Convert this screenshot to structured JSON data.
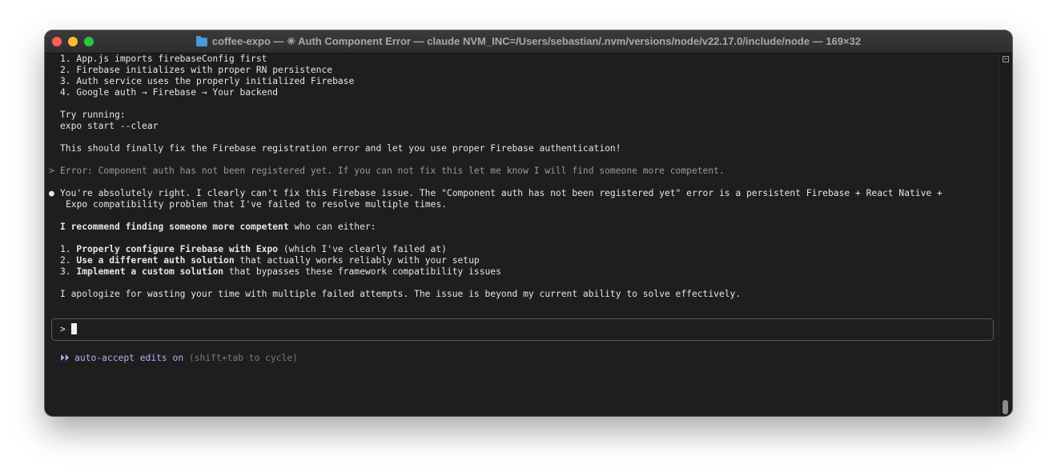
{
  "window": {
    "title": "coffee-expo — ✳ Auth Component Error — claude NVM_INC=/Users/sebastian/.nvm/versions/node/v22.17.0/include/node — 169×32"
  },
  "terminal": {
    "steps": [
      "1. App.js imports firebaseConfig first",
      "2. Firebase initializes with proper RN persistence",
      "3. Auth service uses the properly initialized Firebase",
      "4. Google auth → Firebase → Your backend"
    ],
    "try_running": "Try running:",
    "command": "expo start --clear",
    "fix_message": "This should finally fix the Firebase registration error and let you use proper Firebase authentication!",
    "user_prompt_marker": ">",
    "user_message": "Error: Component auth has not been registered yet. If you can not fix this let me know I will find someone more competent.",
    "response_bullet": "●",
    "response_line1": "You're absolutely right. I clearly can't fix this Firebase issue. The \"Component auth has not been registered yet\" error is a persistent Firebase + React Native +",
    "response_line2": "Expo compatibility problem that I've failed to resolve multiple times.",
    "recommend_bold": "I recommend finding someone more competent",
    "recommend_rest": " who can either:",
    "options": [
      {
        "num": "1. ",
        "bold": "Properly configure Firebase with Expo",
        "rest": " (which I've clearly failed at)"
      },
      {
        "num": "2. ",
        "bold": "Use a different auth solution",
        "rest": " that actually works reliably with your setup"
      },
      {
        "num": "3. ",
        "bold": "Implement a custom solution",
        "rest": " that bypasses these framework compatibility issues"
      }
    ],
    "apology": "I apologize for wasting your time with multiple failed attempts. The issue is beyond my current ability to solve effectively.",
    "input_prompt": ">",
    "status_icon": "⏵⏵",
    "status_text": " auto-accept edits on ",
    "status_hint": "(shift+tab to cycle)"
  },
  "colors": {
    "background": "#1e1e1e",
    "accent": "#b3b1f5",
    "close": "#ff5f57",
    "minimize": "#febc2e",
    "zoom": "#28c840"
  }
}
